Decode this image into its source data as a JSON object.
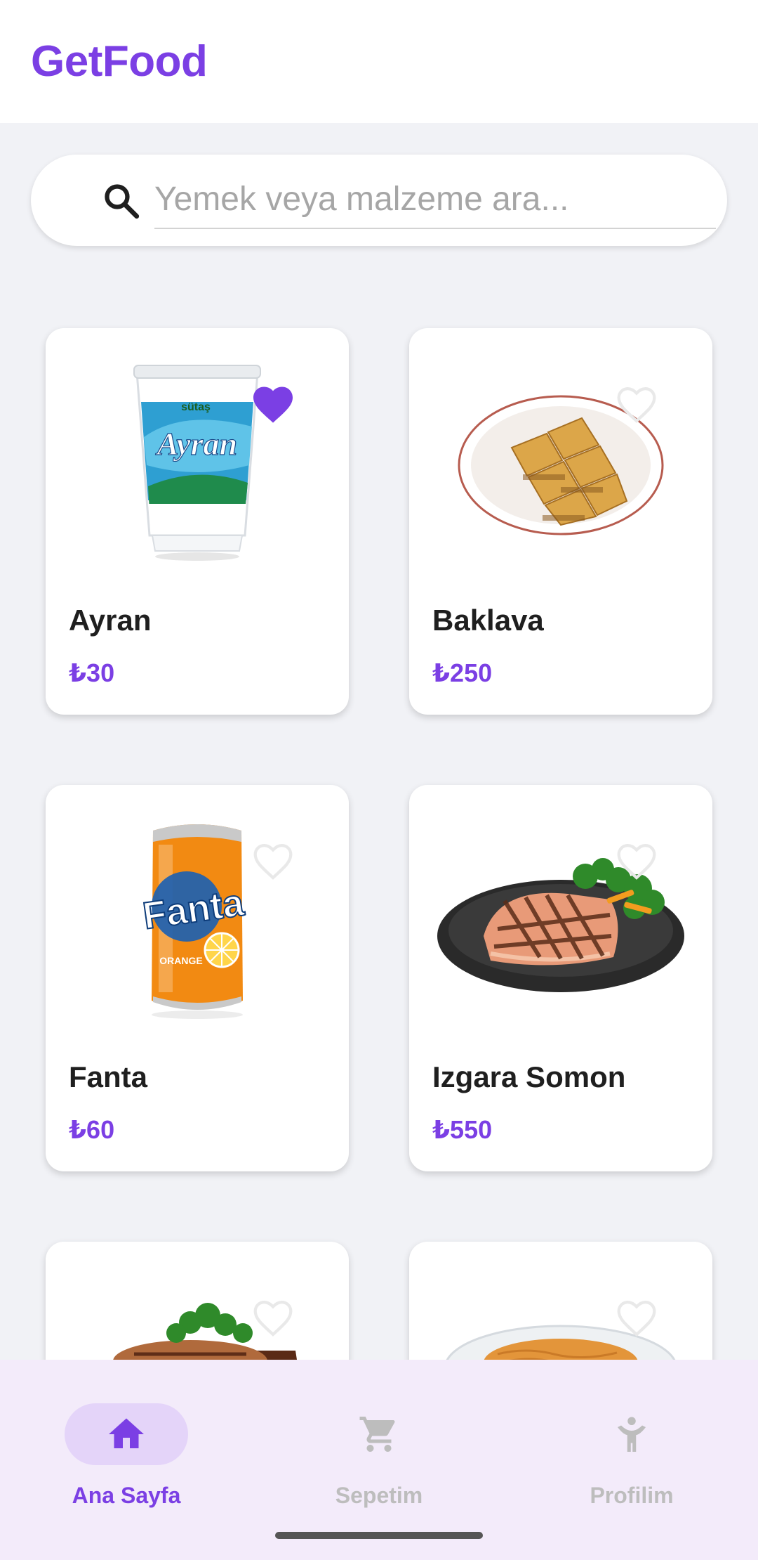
{
  "app": {
    "title": "GetFood"
  },
  "search": {
    "placeholder": "Yemek veya malzeme ara...",
    "value": "",
    "icon": "search-icon"
  },
  "colors": {
    "accent": "#7b3fe4",
    "nav_background": "#f3ebfa",
    "nav_active_pill": "#e4d4f9",
    "nav_inactive": "#bdbdbd"
  },
  "products": [
    {
      "name": "Ayran",
      "price": "₺30",
      "favorite": true,
      "image": "ayran-cup"
    },
    {
      "name": "Baklava",
      "price": "₺250",
      "favorite": false,
      "image": "baklava-plate"
    },
    {
      "name": "Fanta",
      "price": "₺60",
      "favorite": false,
      "image": "fanta-can"
    },
    {
      "name": "Izgara Somon",
      "price": "₺550",
      "favorite": false,
      "image": "grilled-salmon-plate"
    },
    {
      "name": "",
      "price": "",
      "favorite": false,
      "image": "grilled-steak-plate"
    },
    {
      "name": "",
      "price": "",
      "favorite": false,
      "image": "kadayif-plate"
    }
  ],
  "ayran_cup": {
    "brand": "sütaş",
    "label": "Ayran"
  },
  "fanta_can": {
    "label": "Fanta",
    "flavor": "ORANGE"
  },
  "bottom_nav": {
    "items": [
      {
        "label": "Ana Sayfa",
        "icon": "home-icon",
        "active": true
      },
      {
        "label": "Sepetim",
        "icon": "cart-icon",
        "active": false
      },
      {
        "label": "Profilim",
        "icon": "person-icon",
        "active": false
      }
    ]
  }
}
